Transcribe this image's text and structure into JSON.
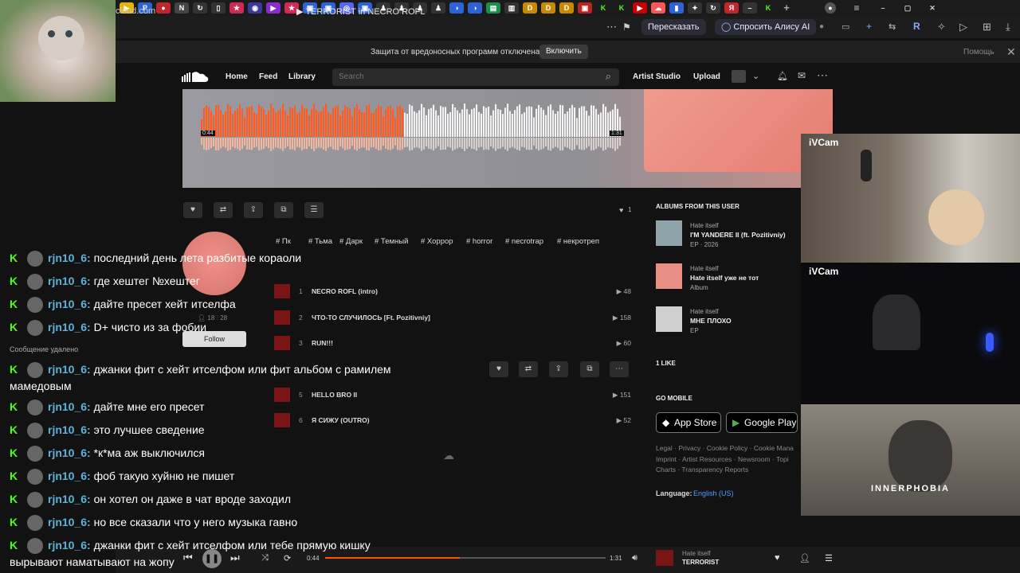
{
  "browser": {
    "url": "cloud.com",
    "tab_title": "▶ TERRORIST in NECRO ROFL",
    "retell_label": "Пересказать",
    "alice_label": "Спросить Алису AI",
    "warning_text": "Защита от вредоносных программ отключена",
    "warning_button": "Включить",
    "warning_help": "Помощь"
  },
  "nav": {
    "home": "Home",
    "feed": "Feed",
    "library": "Library",
    "search_placeholder": "Search",
    "artist_studio": "Artist Studio",
    "upload": "Upload"
  },
  "waveform": {
    "current_time": "0:44",
    "duration": "1:31",
    "progress": 0.48
  },
  "likes_count": "1",
  "tags": [
    "# Пк",
    "# Тьма",
    "# Дарк",
    "# Темный",
    "# Хоррор",
    "# horror",
    "# necrotrap",
    "# некротреп"
  ],
  "tracks": [
    {
      "num": "1",
      "title": "NECRO ROFL (intro)",
      "plays": "48"
    },
    {
      "num": "2",
      "title": "ЧТО-ТО СЛУЧИЛОСЬ [Ft. Pozitivniy]",
      "plays": "158"
    },
    {
      "num": "3",
      "title": "RUN!!!",
      "plays": "60"
    },
    {
      "num": "5",
      "title": "HELLO BRO II",
      "plays": "151"
    },
    {
      "num": "6",
      "title": "Я СИЖУ (OUTRO)",
      "plays": "52"
    }
  ],
  "artist_card": {
    "followers": "18",
    "following": "28",
    "follow_label": "Follow"
  },
  "sidebar": {
    "albums_heading": "ALBUMS FROM THIS USER",
    "albums": [
      {
        "user": "Hate itself",
        "title": "I'M YANDERE II (ft. Pozitivniy)",
        "meta": "EP · 2026",
        "color": "#8fa4a8"
      },
      {
        "user": "Hate itself",
        "title": "Hate itself уже не тот",
        "meta": "Album",
        "color": "#e88f85"
      },
      {
        "user": "Hate itself",
        "title": "МНЕ ПЛОХО",
        "meta": "EP",
        "color": "#cfcfcf"
      }
    ],
    "likes_heading": "1 LIKE",
    "mobile_heading": "GO MOBILE",
    "app_store": "App Store",
    "google_play": "Google Play",
    "footer_lines": [
      "Legal · Privacy · Cookie Policy · Cookie Mana",
      "Imprint · Artist Resources · Newsroom · Topi",
      "Charts · Transparency Reports"
    ],
    "language_label": "Language:",
    "language_value": "English (US)"
  },
  "chat": {
    "messages": [
      {
        "user": "rjn10_6",
        "text": "последний день лета разбитые кораоли"
      },
      {
        "user": "rjn10_6",
        "text": "где хештег №хештег"
      },
      {
        "user": "rjn10_6",
        "text": "дайте пресет хейт итселфа"
      },
      {
        "user": "rjn10_6",
        "text": "D+ чисто из за фобии"
      },
      {
        "user": "rjn10_6",
        "text": "джанки фит с хейт итселфом или фит альбом с рамилем мамедовым"
      },
      {
        "user": "rjn10_6",
        "text": "дайте мне его пресет"
      },
      {
        "user": "rjn10_6",
        "text": "это лучшее сведение"
      },
      {
        "user": "rjn10_6",
        "text": "*к*ма аж выключился"
      },
      {
        "user": "rjn10_6",
        "text": "фоб такую хуйню не пишет"
      },
      {
        "user": "rjn10_6",
        "text": "он хотел он даже в чат вроде заходил"
      },
      {
        "user": "rjn10_6",
        "text": "но все сказали что у него музыка гавно"
      },
      {
        "user": "rjn10_6",
        "text": "джанки фит с хейт итселфом или тебе прямую кишку вырывают наматывают на жопу"
      }
    ],
    "deleted_text": "Сообщение удалено",
    "user_suffix": ":"
  },
  "player": {
    "current_time": "0:44",
    "duration": "1:31",
    "progress": 0.48,
    "artist": "Hate itself",
    "title": "TERRORIST"
  },
  "cams": {
    "top_label": "iVCam",
    "bottom_label": "iVCam",
    "brand_text": "INNERPHOBIA"
  }
}
